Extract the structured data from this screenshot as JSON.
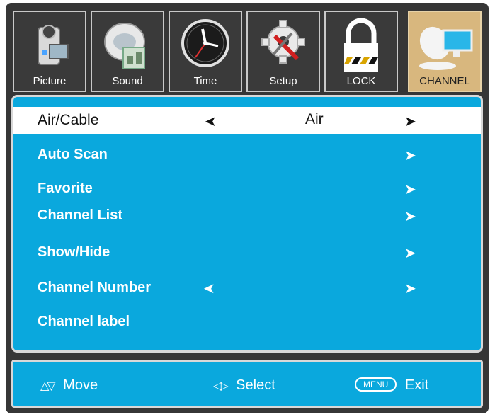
{
  "tabs": [
    {
      "label": "Picture",
      "icon": "camcorder-icon",
      "active": false
    },
    {
      "label": "Sound",
      "icon": "speaker-disc-icon",
      "active": false
    },
    {
      "label": "Time",
      "icon": "clock-icon",
      "active": false
    },
    {
      "label": "Setup",
      "icon": "gear-tools-icon",
      "active": false
    },
    {
      "label": "LOCK",
      "icon": "padlock-icon",
      "active": false
    },
    {
      "label": "CHANNEL",
      "icon": "satellite-dish-icon",
      "active": true
    }
  ],
  "menu": {
    "air_cable": {
      "label": "Air/Cable",
      "value": "Air"
    },
    "items": [
      {
        "label": "Auto Scan"
      },
      {
        "label": "Favorite"
      },
      {
        "label": "Channel List"
      },
      {
        "label": "Show/Hide"
      },
      {
        "label": "Channel Number"
      },
      {
        "label": "Channel label"
      }
    ]
  },
  "footer": {
    "move_label": "Move",
    "select_label": "Select",
    "menu_key": "MENU",
    "exit_label": "Exit"
  },
  "colors": {
    "panel": "#0aa8dd",
    "frame": "#363636",
    "active_tab": "#d8b77e",
    "highlight_row": "#ffffff"
  }
}
